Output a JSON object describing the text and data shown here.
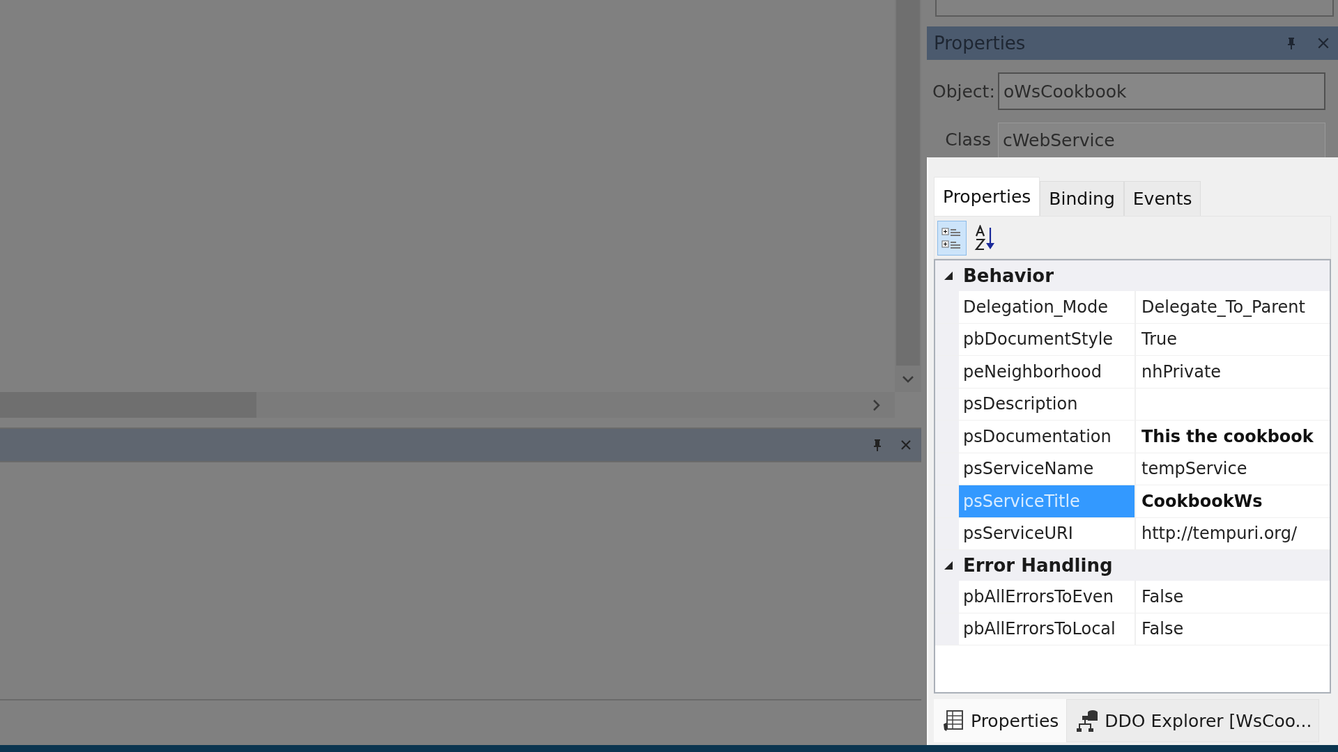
{
  "properties_panel": {
    "title": "Properties",
    "object_label": "Object:",
    "object_value": "oWsCookbook",
    "class_label": "Class",
    "class_value": "cWebService",
    "tabs": [
      {
        "label": "Properties",
        "selected": true
      },
      {
        "label": "Binding",
        "selected": false
      },
      {
        "label": "Events",
        "selected": false
      }
    ],
    "toolbar": [
      {
        "kind": "categorized",
        "selected": true
      },
      {
        "kind": "alphabetical",
        "selected": false
      }
    ],
    "categories": [
      {
        "name": "Behavior",
        "expanded": true,
        "children": [
          {
            "name": "Delegation_Mode",
            "value": "Delegate_To_Parent",
            "selected": false
          },
          {
            "name": "pbDocumentStyle",
            "value": "True",
            "selected": false
          },
          {
            "name": "peNeighborhood",
            "value": "nhPrivate",
            "selected": false
          },
          {
            "name": "psDescription",
            "selected": false
          },
          {
            "name": "psDocumentation",
            "value": "This the cookbook",
            "bold": true,
            "selected": false
          },
          {
            "name": "psServiceName",
            "value": "tempService",
            "selected": false
          },
          {
            "name": "psServiceTitle",
            "value": "CookbookWs",
            "bold": true,
            "selected": true
          },
          {
            "name": "psServiceURI",
            "value": "http://tempuri.org/",
            "selected": false
          }
        ]
      },
      {
        "name": "Error Handling",
        "expanded": true,
        "children": [
          {
            "name": "pbAllErrorsToEven",
            "value": "False",
            "selected": false
          },
          {
            "name": "pbAllErrorsToLocal",
            "value": "False",
            "selected": false
          }
        ]
      }
    ],
    "bottom_tabs": [
      {
        "kind": "properties",
        "label": "Properties",
        "selected": true
      },
      {
        "kind": "ddo",
        "label": "DDO Explorer [WsCoo...",
        "selected": false
      }
    ]
  }
}
